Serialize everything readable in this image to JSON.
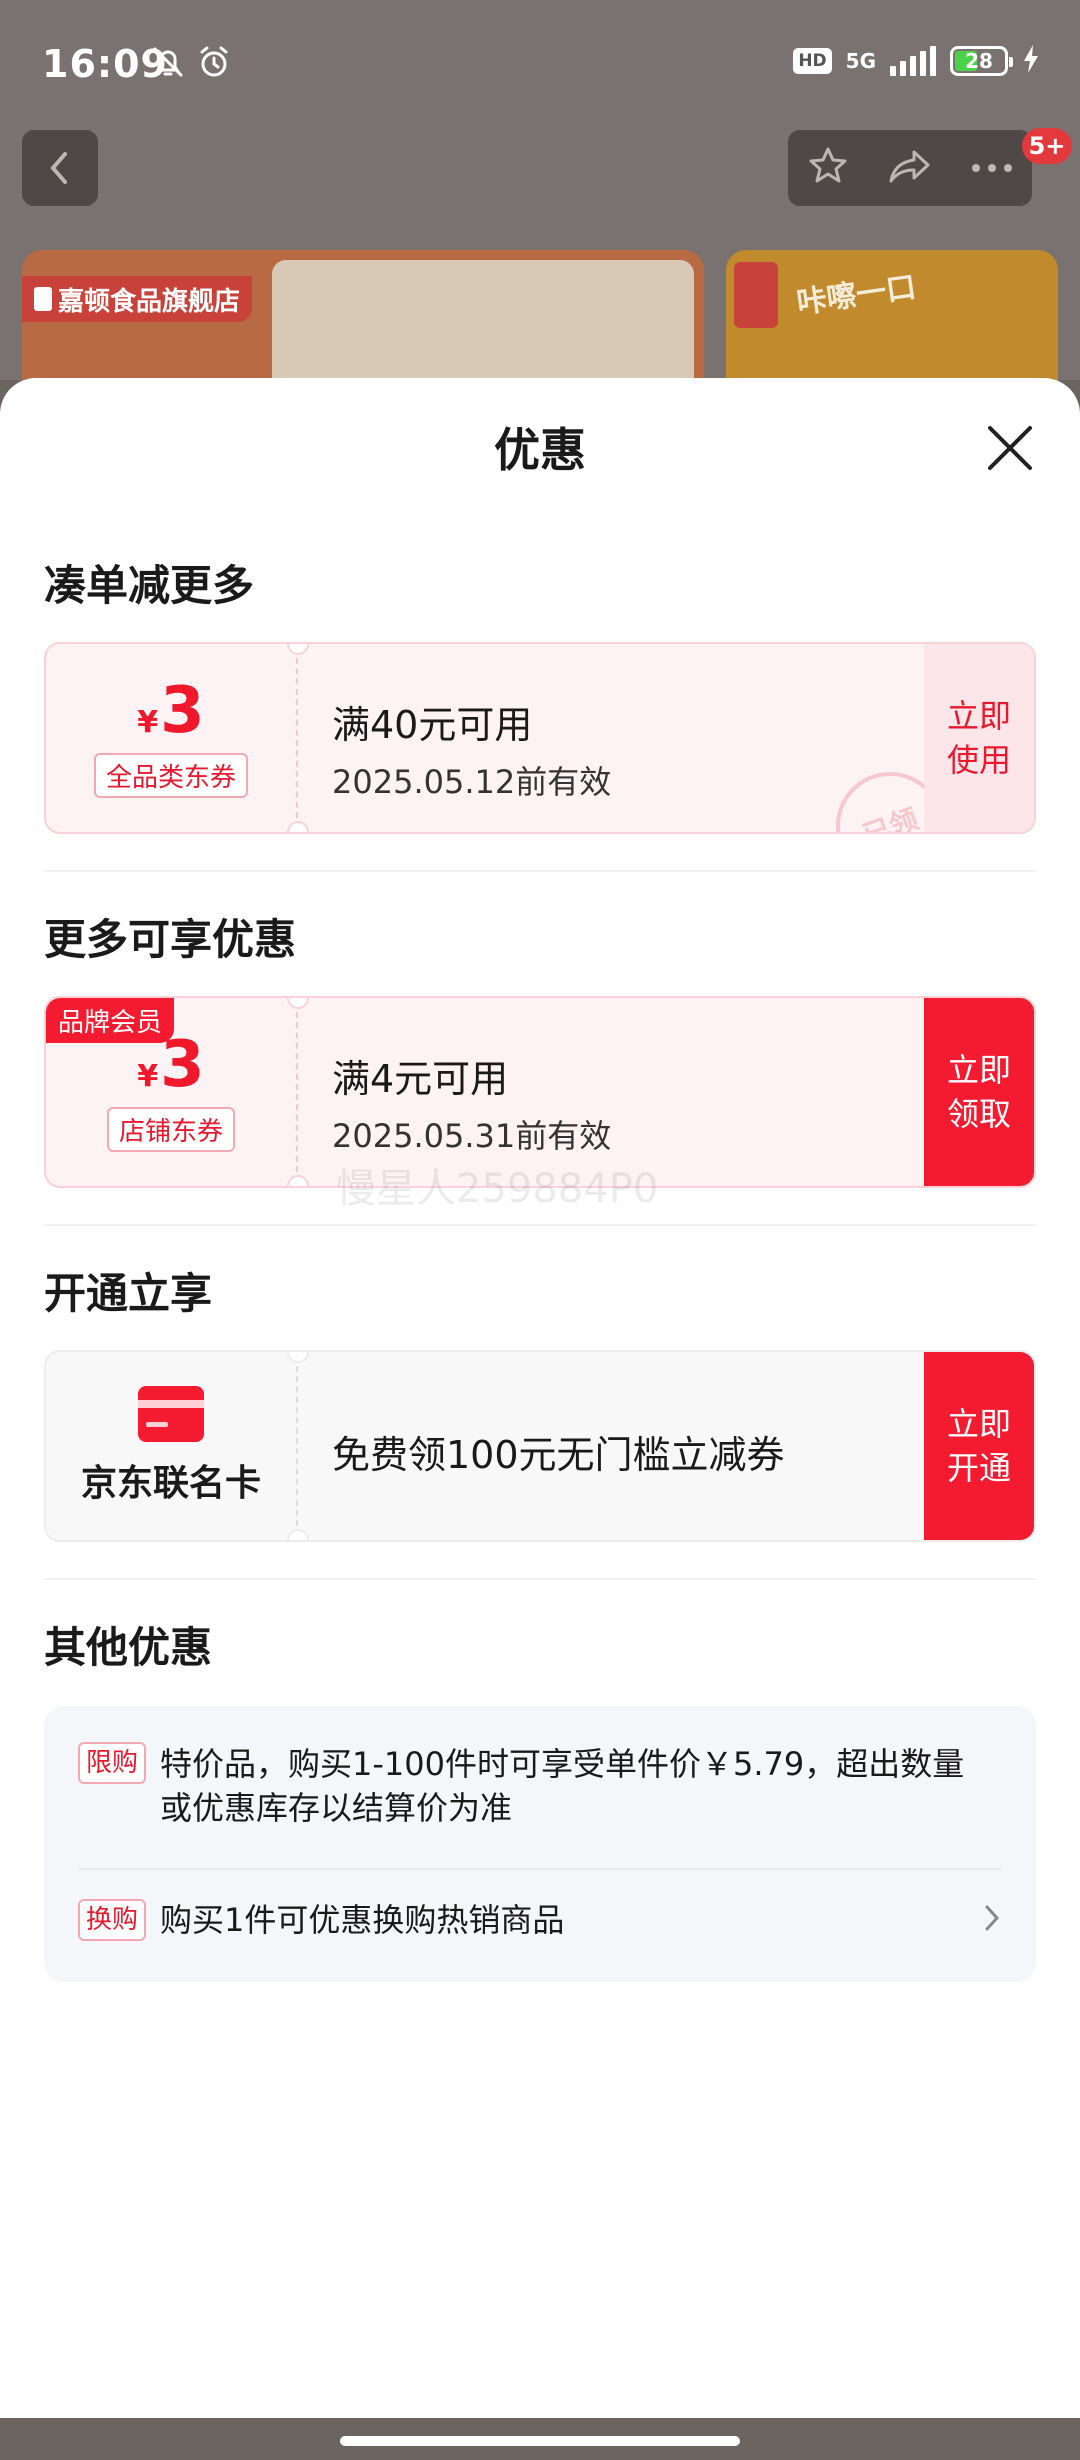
{
  "status_bar": {
    "time": "16:09",
    "hd": "HD",
    "network": "5G",
    "battery": "28"
  },
  "nav": {
    "badge": "5+"
  },
  "background": {
    "store_name": "嘉顿食品旗舰店",
    "slogan": "咔嚓一口"
  },
  "sheet": {
    "title": "优惠",
    "sections": [
      {
        "title": "凑单减更多",
        "coupon": {
          "currency": "¥",
          "amount": "3",
          "tag": "全品类东券",
          "condition": "满40元可用",
          "validity": "2025.05.12前有效",
          "action": "立即使用",
          "stamp": "已领"
        }
      },
      {
        "title": "更多可享优惠",
        "coupon": {
          "member_tag": "品牌会员",
          "currency": "¥",
          "amount": "3",
          "tag": "店铺东券",
          "condition": "满4元可用",
          "validity": "2025.05.31前有效",
          "action": "立即领取"
        }
      },
      {
        "title": "开通立享",
        "card": {
          "name": "京东联名卡",
          "description": "免费领100元无门槛立减券",
          "action": "立即开通"
        }
      },
      {
        "title": "其他优惠",
        "items": [
          {
            "tag": "限购",
            "text": "特价品，购买1-100件时可享受单件价￥5.79，超出数量或优惠库存以结算价为准"
          },
          {
            "tag": "换购",
            "text": "购买1件可优惠换购热销商品"
          }
        ]
      }
    ],
    "watermark": "慢星人259884P0"
  },
  "colors": {
    "accent": "#f41a30",
    "pale": "#fde6ea"
  }
}
